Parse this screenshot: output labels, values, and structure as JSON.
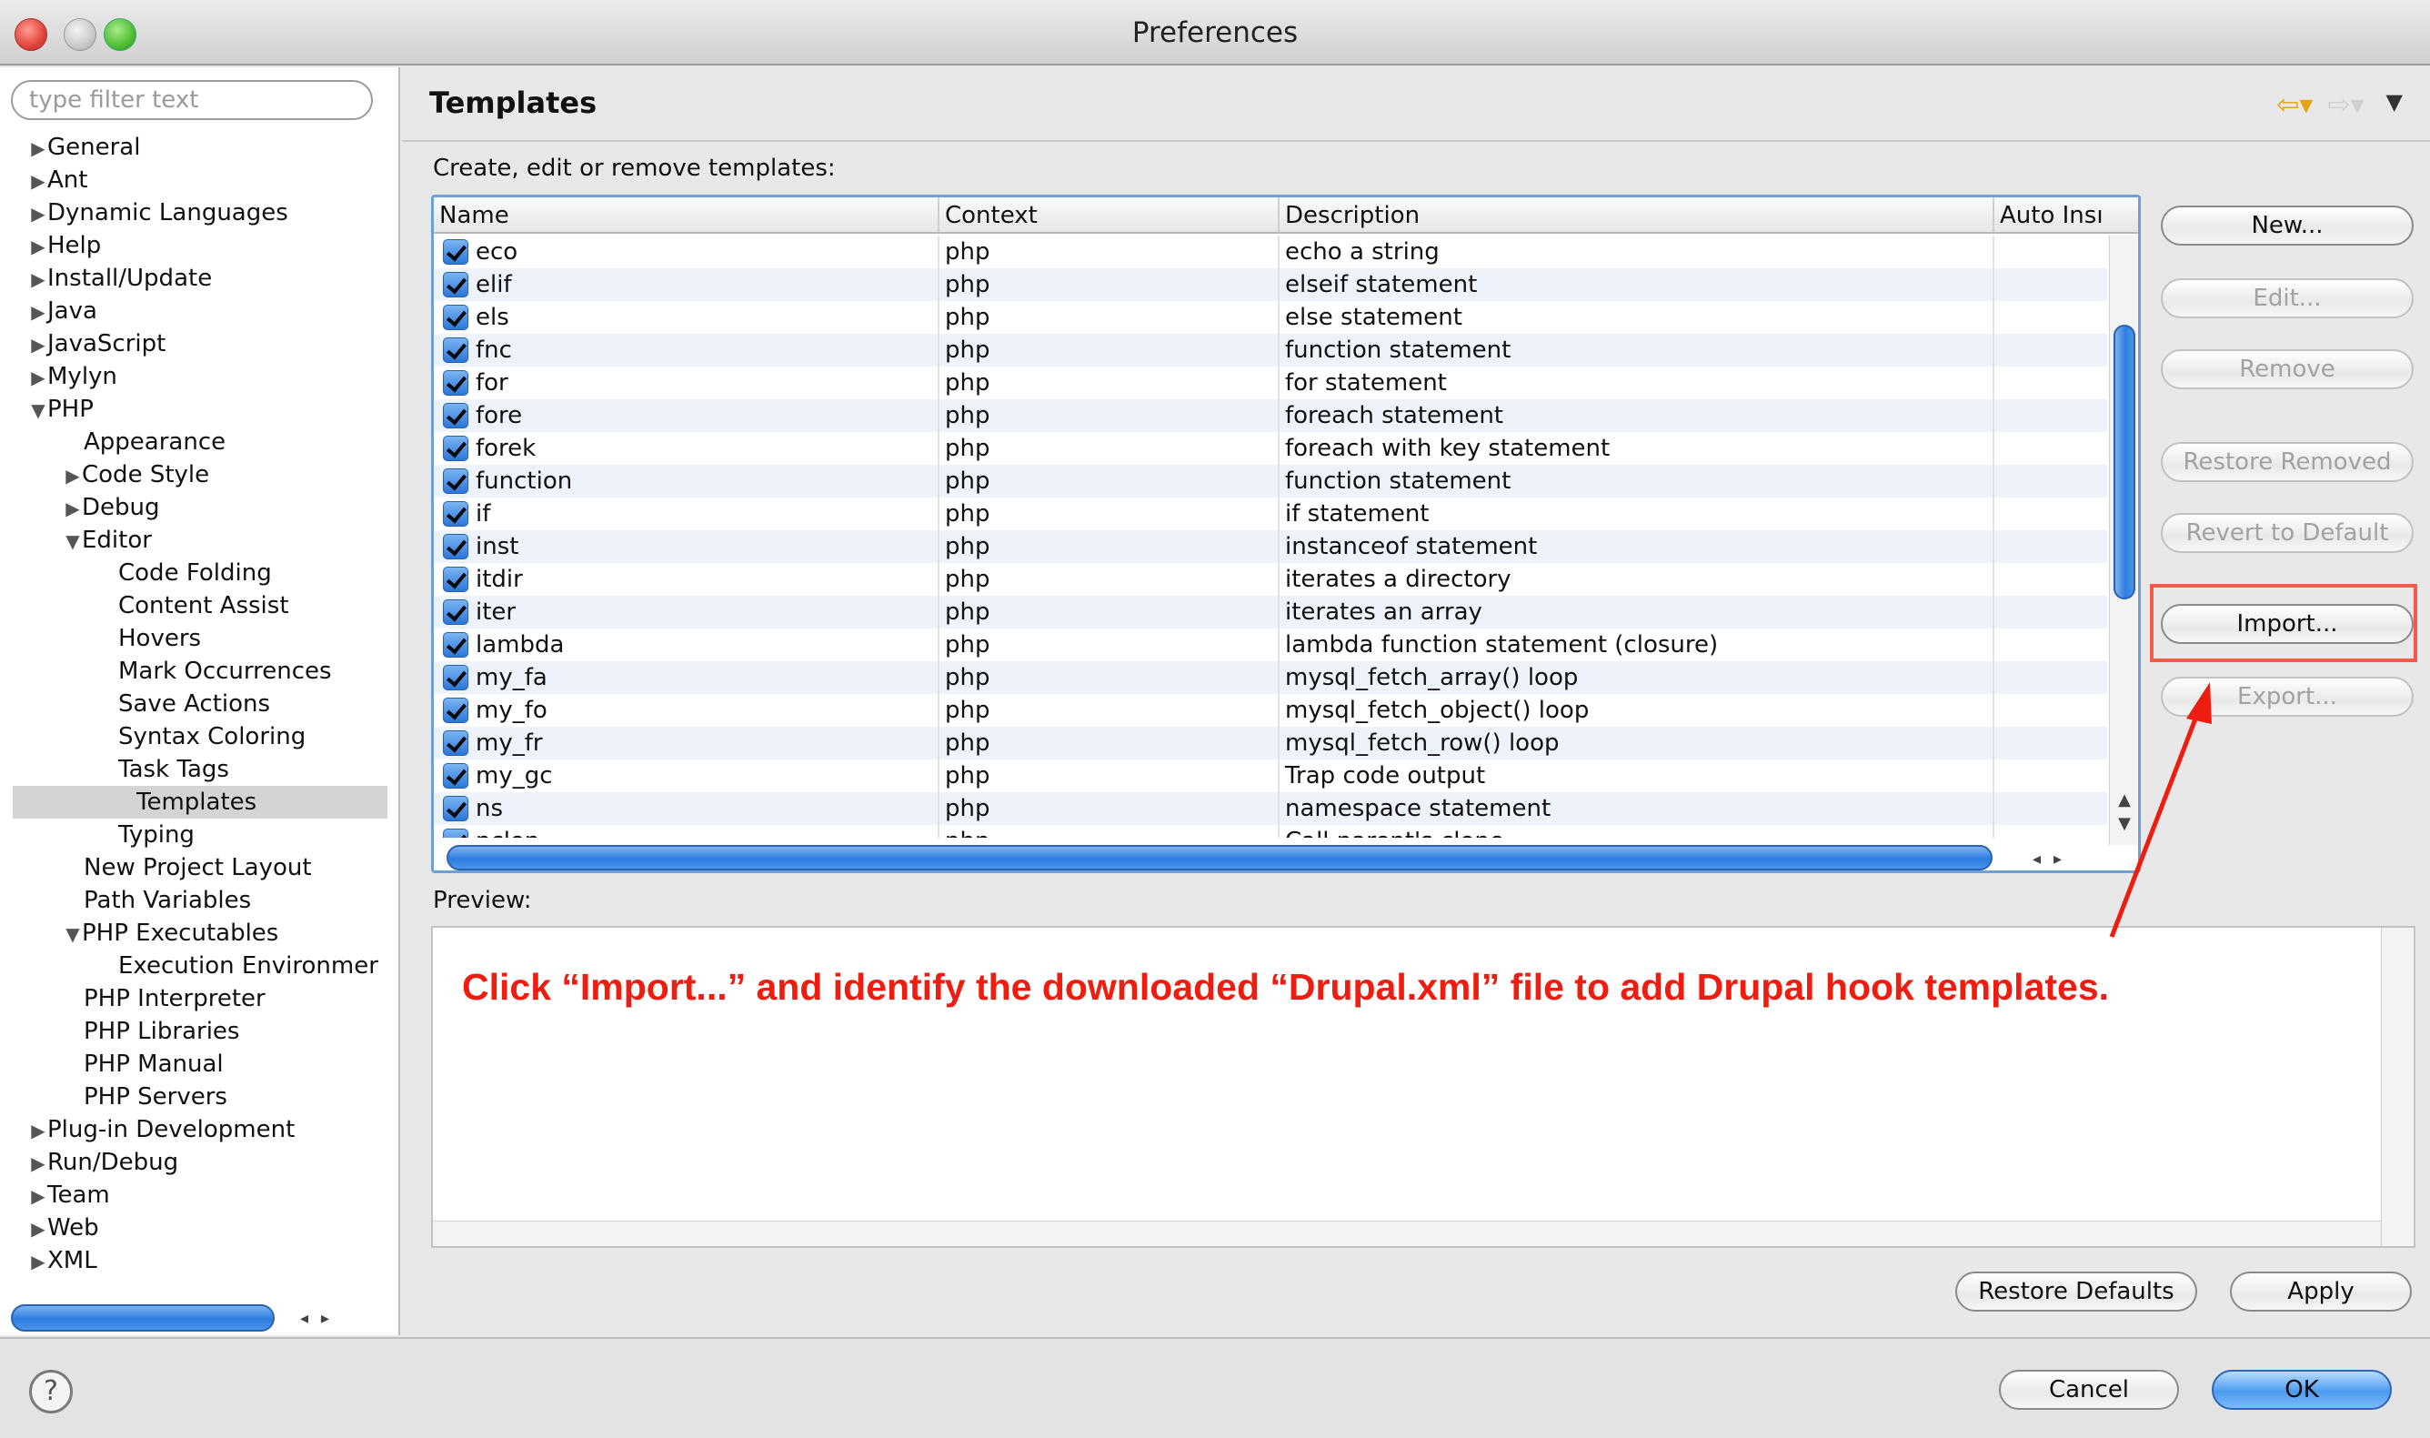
{
  "window": {
    "title": "Preferences"
  },
  "sidebar": {
    "filter_placeholder": "type filter text",
    "items": [
      {
        "label": "General",
        "level": 0,
        "state": "collapsed"
      },
      {
        "label": "Ant",
        "level": 0,
        "state": "collapsed"
      },
      {
        "label": "Dynamic Languages",
        "level": 0,
        "state": "collapsed"
      },
      {
        "label": "Help",
        "level": 0,
        "state": "collapsed"
      },
      {
        "label": "Install/Update",
        "level": 0,
        "state": "collapsed"
      },
      {
        "label": "Java",
        "level": 0,
        "state": "collapsed"
      },
      {
        "label": "JavaScript",
        "level": 0,
        "state": "collapsed"
      },
      {
        "label": "Mylyn",
        "level": 0,
        "state": "collapsed"
      },
      {
        "label": "PHP",
        "level": 0,
        "state": "expanded"
      },
      {
        "label": "Appearance",
        "level": 1,
        "state": "leaf"
      },
      {
        "label": "Code Style",
        "level": 1,
        "state": "collapsed"
      },
      {
        "label": "Debug",
        "level": 1,
        "state": "collapsed"
      },
      {
        "label": "Editor",
        "level": 1,
        "state": "expanded"
      },
      {
        "label": "Code Folding",
        "level": 2,
        "state": "leaf"
      },
      {
        "label": "Content Assist",
        "level": 2,
        "state": "leaf"
      },
      {
        "label": "Hovers",
        "level": 2,
        "state": "leaf"
      },
      {
        "label": "Mark Occurrences",
        "level": 2,
        "state": "leaf"
      },
      {
        "label": "Save Actions",
        "level": 2,
        "state": "leaf"
      },
      {
        "label": "Syntax Coloring",
        "level": 2,
        "state": "leaf"
      },
      {
        "label": "Task Tags",
        "level": 2,
        "state": "leaf"
      },
      {
        "label": "Templates",
        "level": 2,
        "state": "leaf",
        "selected": true
      },
      {
        "label": "Typing",
        "level": 2,
        "state": "leaf"
      },
      {
        "label": "New Project Layout",
        "level": 1,
        "state": "leaf"
      },
      {
        "label": "Path Variables",
        "level": 1,
        "state": "leaf"
      },
      {
        "label": "PHP Executables",
        "level": 1,
        "state": "expanded"
      },
      {
        "label": "Execution Environmer",
        "level": 2,
        "state": "leaf"
      },
      {
        "label": "PHP Interpreter",
        "level": 1,
        "state": "leaf"
      },
      {
        "label": "PHP Libraries",
        "level": 1,
        "state": "leaf"
      },
      {
        "label": "PHP Manual",
        "level": 1,
        "state": "leaf"
      },
      {
        "label": "PHP Servers",
        "level": 1,
        "state": "leaf"
      },
      {
        "label": "Plug-in Development",
        "level": 0,
        "state": "collapsed"
      },
      {
        "label": "Run/Debug",
        "level": 0,
        "state": "collapsed"
      },
      {
        "label": "Team",
        "level": 0,
        "state": "collapsed"
      },
      {
        "label": "Web",
        "level": 0,
        "state": "collapsed"
      },
      {
        "label": "XML",
        "level": 0,
        "state": "collapsed"
      }
    ]
  },
  "main": {
    "title": "Templates",
    "section_label": "Create, edit or remove templates:",
    "columns": {
      "name": "Name",
      "context": "Context",
      "description": "Description",
      "auto_insert": "Auto Insı"
    },
    "templates": [
      {
        "name": "eco",
        "context": "php",
        "description": "echo a string",
        "checked": true
      },
      {
        "name": "elif",
        "context": "php",
        "description": "elseif statement",
        "checked": true
      },
      {
        "name": "els",
        "context": "php",
        "description": "else statement",
        "checked": true
      },
      {
        "name": "fnc",
        "context": "php",
        "description": "function statement",
        "checked": true
      },
      {
        "name": "for",
        "context": "php",
        "description": "for statement",
        "checked": true
      },
      {
        "name": "fore",
        "context": "php",
        "description": "foreach statement",
        "checked": true
      },
      {
        "name": "forek",
        "context": "php",
        "description": "foreach with key statement",
        "checked": true
      },
      {
        "name": "function",
        "context": "php",
        "description": "function statement",
        "checked": true
      },
      {
        "name": "if",
        "context": "php",
        "description": "if statement",
        "checked": true
      },
      {
        "name": "inst",
        "context": "php",
        "description": "instanceof statement",
        "checked": true
      },
      {
        "name": "itdir",
        "context": "php",
        "description": "iterates a directory",
        "checked": true
      },
      {
        "name": "iter",
        "context": "php",
        "description": "iterates an array",
        "checked": true
      },
      {
        "name": "lambda",
        "context": "php",
        "description": "lambda function statement (closure)",
        "checked": true
      },
      {
        "name": "my_fa",
        "context": "php",
        "description": "mysql_fetch_array() loop",
        "checked": true
      },
      {
        "name": "my_fo",
        "context": "php",
        "description": "mysql_fetch_object() loop",
        "checked": true
      },
      {
        "name": "my_fr",
        "context": "php",
        "description": "mysql_fetch_row() loop",
        "checked": true
      },
      {
        "name": "my_gc",
        "context": "php",
        "description": "Trap code output",
        "checked": true
      },
      {
        "name": "ns",
        "context": "php",
        "description": "namespace statement",
        "checked": true
      },
      {
        "name": "pclon",
        "context": "php",
        "description": "Call parent's clone",
        "checked": true
      }
    ],
    "buttons": {
      "new": "New...",
      "edit": "Edit...",
      "remove": "Remove",
      "restore_removed": "Restore Removed",
      "revert_default": "Revert to Default",
      "import": "Import...",
      "export": "Export..."
    },
    "preview_label": "Preview:",
    "annotation": "Click “Import...” and identify the downloaded “Drupal.xml” file to add Drupal hook templates.",
    "restore_defaults": "Restore Defaults",
    "apply": "Apply"
  },
  "footer": {
    "help": "?",
    "cancel": "Cancel",
    "ok": "OK"
  },
  "colors": {
    "annotation": "#ef1d10",
    "accent": "#2d7ee0",
    "highlight_box": "#f25a4a"
  }
}
